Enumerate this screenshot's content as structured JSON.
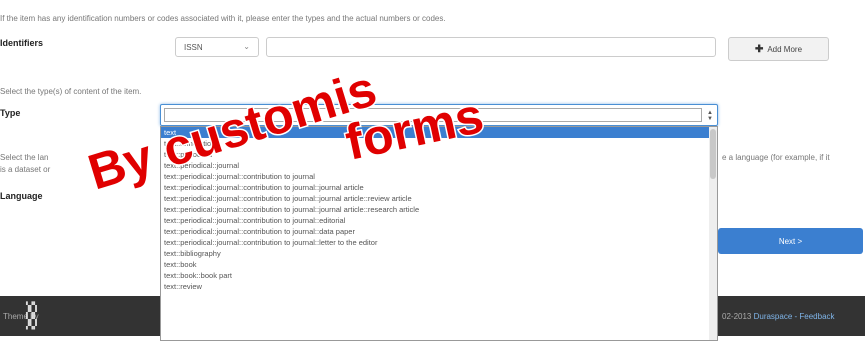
{
  "identifiers": {
    "hint": "If the item has any identification numbers or codes associated with it, please enter the types and the actual numbers or codes.",
    "label": "Identifiers",
    "qualifier_value": "ISSN",
    "add_more_label": "Add More"
  },
  "type": {
    "hint": "Select the type(s) of content of the item.",
    "label": "Type",
    "options": [
      "text",
      "text::annotation",
      "text::periodical",
      "text::periodical::journal",
      "text::periodical::journal::contribution to journal",
      "text::periodical::journal::contribution to journal::journal article",
      "text::periodical::journal::contribution to journal::journal article::review article",
      "text::periodical::journal::contribution to journal::journal article::research article",
      "text::periodical::journal::contribution to journal::editorial",
      "text::periodical::journal::contribution to journal::data paper",
      "text::periodical::journal::contribution to journal::letter to the editor",
      "text::bibliography",
      "text::book",
      "text::book::book part",
      "text::review"
    ],
    "selected_index": 0
  },
  "language": {
    "hint": "Select the language of the main content of the item. If the language does not appear in the list, please select 'Other'. If the content does not really have a language (for example, if it is a dataset or an image) please select 'N/A'.",
    "hint_left": "Select the lan",
    "hint_left2": "is a dataset or",
    "hint_right": "e a language (for example, if it",
    "label": "Language"
  },
  "nav": {
    "next_label": "Next >"
  },
  "footer": {
    "theme_label": "Theme by",
    "copyright": "02-2013",
    "link": "Duraspace - Feedback"
  },
  "overlay": {
    "line1": "By customis",
    "line2": "forms",
    "color": "#e00000"
  }
}
